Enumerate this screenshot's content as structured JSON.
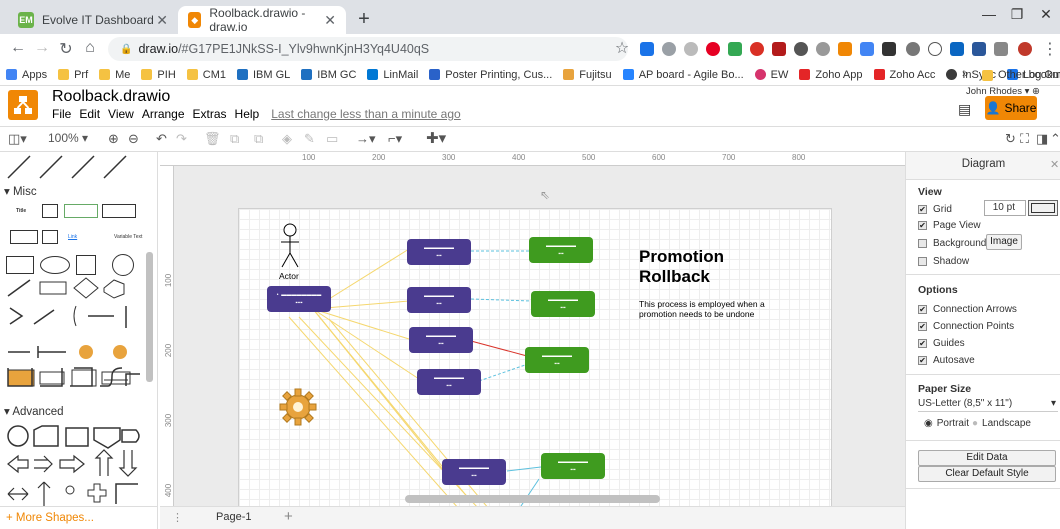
{
  "browser": {
    "tabs": [
      {
        "label": "Evolve IT Dashboard",
        "icon": "evolve-icon"
      },
      {
        "label": "Roolback.drawio - draw.io",
        "icon": "drawio-icon"
      }
    ],
    "url_host": "draw.io",
    "url_path": "/#G17PE1JNkSS-I_Ylv9hwnKjnH3Yq4U40qS",
    "bookmarks": [
      "Apps",
      "Prf",
      "Me",
      "PIH",
      "CM1",
      "IBM GL",
      "IBM GC",
      "LinMail",
      "Poster Printing, Cus...",
      "Fujitsu",
      "AP board - Agile Bo...",
      "EW",
      "Zoho App",
      "Zoho Acc",
      "InSync",
      "Log Out"
    ],
    "other_bookmarks": "Other bookmarks",
    "overflow": "»"
  },
  "app": {
    "title": "Roolback.drawio",
    "menus": [
      "File",
      "Edit",
      "View",
      "Arrange",
      "Extras",
      "Help"
    ],
    "last_change": "Last change less than a minute ago",
    "user": "John Rhodes",
    "share_label": "Share",
    "zoom": "100%"
  },
  "left_panel": {
    "misc_label": "Misc",
    "advanced_label": "Advanced",
    "more_shapes": "+ More Shapes...",
    "title_shape": "Title",
    "link_shape": "Link",
    "variable_text": "Variable Text"
  },
  "canvas": {
    "actor_label": "Actor",
    "heading_line1": "Promotion",
    "heading_line2": "Rollback",
    "description": "This process is employed when a promotion needs to be undone",
    "ruler_marks": [
      "100",
      "200",
      "300",
      "400",
      "500",
      "600",
      "700",
      "800"
    ],
    "ruler_left": [
      "100",
      "200",
      "300",
      "400"
    ]
  },
  "page_tabs": {
    "current": "Page-1"
  },
  "right_panel": {
    "header": "Diagram",
    "view_label": "View",
    "grid": "Grid",
    "grid_size": "10 pt",
    "page_view": "Page View",
    "background": "Background",
    "image_button": "Image",
    "shadow": "Shadow",
    "options_label": "Options",
    "connection_arrows": "Connection Arrows",
    "connection_points": "Connection Points",
    "guides": "Guides",
    "autosave": "Autosave",
    "paper_size_label": "Paper Size",
    "paper_size": "US-Letter (8,5\" x 11\")",
    "portrait": "Portrait",
    "landscape": "Landscape",
    "edit_data": "Edit Data",
    "clear_style": "Clear Default Style"
  },
  "colors": {
    "accent": "#f08705",
    "purple_node": "#4a3b8f",
    "green_node": "#3f9b1f"
  }
}
